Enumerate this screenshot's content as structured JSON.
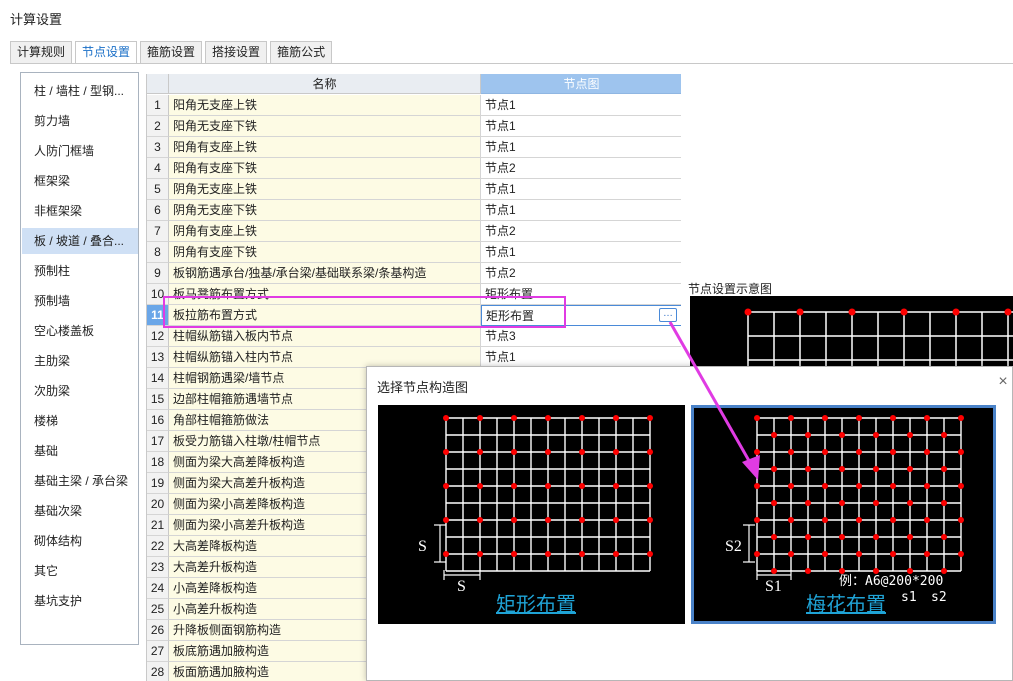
{
  "window": {
    "title": "计算设置"
  },
  "tabs": [
    {
      "label": "计算规则"
    },
    {
      "label": "节点设置"
    },
    {
      "label": "箍筋设置"
    },
    {
      "label": "搭接设置"
    },
    {
      "label": "箍筋公式"
    }
  ],
  "sidebar": {
    "items": [
      {
        "label": "柱 / 墙柱 / 型钢..."
      },
      {
        "label": "剪力墙"
      },
      {
        "label": "人防门框墙"
      },
      {
        "label": "框架梁"
      },
      {
        "label": "非框架梁"
      },
      {
        "label": "板 / 坡道 / 叠合..."
      },
      {
        "label": "预制柱"
      },
      {
        "label": "预制墙"
      },
      {
        "label": "空心楼盖板"
      },
      {
        "label": "主肋梁"
      },
      {
        "label": "次肋梁"
      },
      {
        "label": "楼梯"
      },
      {
        "label": "基础"
      },
      {
        "label": "基础主梁 / 承台梁"
      },
      {
        "label": "基础次梁"
      },
      {
        "label": "砌体结构"
      },
      {
        "label": "其它"
      },
      {
        "label": "基坑支护"
      }
    ]
  },
  "grid": {
    "columns": {
      "name": "名称",
      "node": "节点图"
    },
    "rows": [
      {
        "num": "1",
        "name": "阳角无支座上铁",
        "node": "节点1"
      },
      {
        "num": "2",
        "name": "阳角无支座下铁",
        "node": "节点1"
      },
      {
        "num": "3",
        "name": "阳角有支座上铁",
        "node": "节点1"
      },
      {
        "num": "4",
        "name": "阳角有支座下铁",
        "node": "节点2"
      },
      {
        "num": "5",
        "name": "阴角无支座上铁",
        "node": "节点1"
      },
      {
        "num": "6",
        "name": "阴角无支座下铁",
        "node": "节点1"
      },
      {
        "num": "7",
        "name": "阴角有支座上铁",
        "node": "节点2"
      },
      {
        "num": "8",
        "name": "阴角有支座下铁",
        "node": "节点1"
      },
      {
        "num": "9",
        "name": "板钢筋遇承台/独基/承台梁/基础联系梁/条基构造",
        "node": "节点2"
      },
      {
        "num": "10",
        "name": "板马凳筋布置方式",
        "node": "矩形布置"
      },
      {
        "num": "11",
        "name": "板拉筋布置方式",
        "node": "矩形布置"
      },
      {
        "num": "12",
        "name": "柱帽纵筋锚入板内节点",
        "node": "节点3"
      },
      {
        "num": "13",
        "name": "柱帽纵筋锚入柱内节点",
        "node": "节点1"
      },
      {
        "num": "14",
        "name": "柱帽钢筋遇梁/墙节点",
        "node": ""
      },
      {
        "num": "15",
        "name": "边部柱帽箍筋遇墙节点",
        "node": ""
      },
      {
        "num": "16",
        "name": "角部柱帽箍筋做法",
        "node": ""
      },
      {
        "num": "17",
        "name": "板受力筋锚入柱墩/柱帽节点",
        "node": ""
      },
      {
        "num": "18",
        "name": "侧面为梁大高差降板构造",
        "node": ""
      },
      {
        "num": "19",
        "name": "侧面为梁大高差升板构造",
        "node": ""
      },
      {
        "num": "20",
        "name": "侧面为梁小高差降板构造",
        "node": ""
      },
      {
        "num": "21",
        "name": "侧面为梁小高差升板构造",
        "node": ""
      },
      {
        "num": "22",
        "name": "大高差降板构造",
        "node": ""
      },
      {
        "num": "23",
        "name": "大高差升板构造",
        "node": ""
      },
      {
        "num": "24",
        "name": "小高差降板构造",
        "node": ""
      },
      {
        "num": "25",
        "name": "小高差升板构造",
        "node": ""
      },
      {
        "num": "26",
        "name": "升降板侧面钢筋构造",
        "node": ""
      },
      {
        "num": "27",
        "name": "板底筋遇加腋构造",
        "node": ""
      },
      {
        "num": "28",
        "name": "板面筋遇加腋构造",
        "node": ""
      }
    ]
  },
  "preview": {
    "label": "节点设置示意图"
  },
  "dialog": {
    "title": "选择节点构造图",
    "close_glyph": "×",
    "option_rect": {
      "caption": "矩形布置",
      "dim_s": "S"
    },
    "option_quincunx": {
      "caption": "梅花布置",
      "dim_s2": "S2",
      "dim_s1": "S1",
      "example": "例：A6@200*200",
      "s1": "s1",
      "s2": "s2"
    }
  },
  "icons": {
    "ellipsis": "…"
  },
  "colors": {
    "highlight": "#e03be3",
    "accent": "#1a6fc7",
    "dot": "#ff0000",
    "caption": "#1fa3d6"
  }
}
